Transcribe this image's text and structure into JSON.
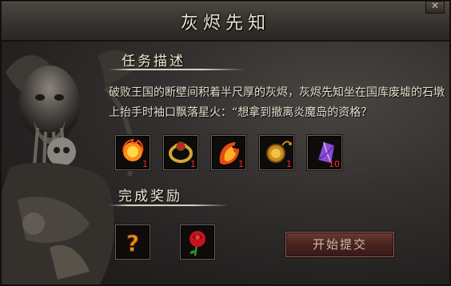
{
  "window": {
    "title": "灰烬先知",
    "close_label": "✕"
  },
  "task": {
    "heading": "任务描述",
    "description": "破败王国的断壁间积着半尺厚的灰烬，灰烬先知坐在国库废墟的石墩上抬手时袖口飘落星火：“想拿到撤离炎魔岛的资格？"
  },
  "required_items": [
    {
      "icon": "fire-orb-icon",
      "qty": "1"
    },
    {
      "icon": "dragon-ring-icon",
      "qty": "1"
    },
    {
      "icon": "fire-dragon-icon",
      "qty": "1"
    },
    {
      "icon": "golden-pocket-watch-icon",
      "qty": "1"
    },
    {
      "icon": "purple-crystal-icon",
      "qty": "10"
    }
  ],
  "reward": {
    "heading": "完成奖励",
    "items": [
      {
        "icon": "question-mark-icon"
      },
      {
        "icon": "red-rose-icon"
      }
    ]
  },
  "submit_button_label": "开始提交",
  "colors": {
    "quantity": "#ff2a2a",
    "title_text": "#e6e0d2",
    "body_text": "#e4ddcc",
    "submit_button": "#4a2320"
  }
}
